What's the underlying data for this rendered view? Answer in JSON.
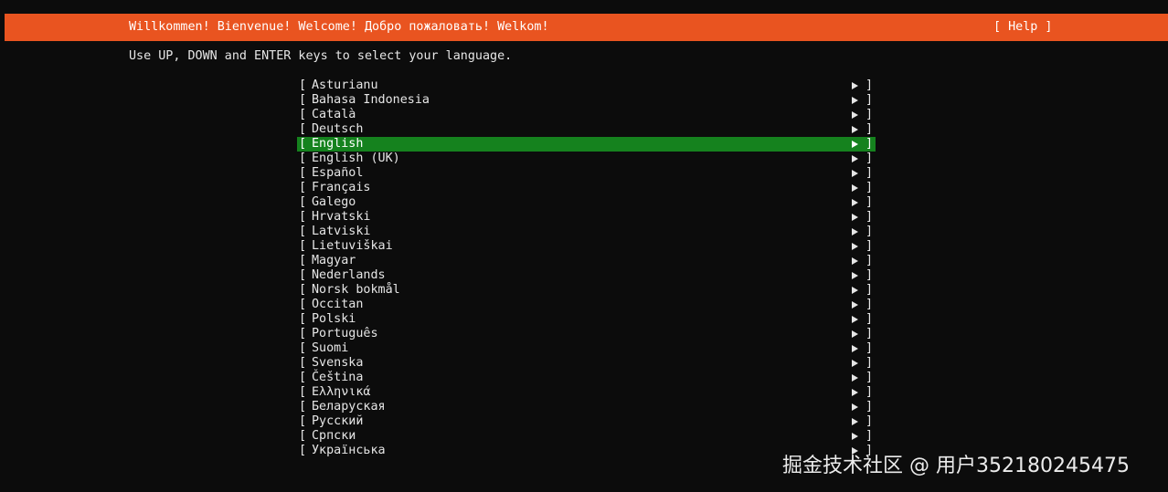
{
  "header": {
    "title": "Willkommen! Bienvenue! Welcome! Добро пожаловать! Welkom!",
    "help_label": "[ Help ]"
  },
  "instructions": "Use UP, DOWN and ENTER keys to select your language.",
  "languages": {
    "items": [
      {
        "label": "Asturianu"
      },
      {
        "label": "Bahasa Indonesia"
      },
      {
        "label": "Català"
      },
      {
        "label": "Deutsch"
      },
      {
        "label": "English",
        "selected": true
      },
      {
        "label": "English (UK)"
      },
      {
        "label": "Español"
      },
      {
        "label": "Français"
      },
      {
        "label": "Galego"
      },
      {
        "label": "Hrvatski"
      },
      {
        "label": "Latviski"
      },
      {
        "label": "Lietuviškai"
      },
      {
        "label": "Magyar"
      },
      {
        "label": "Nederlands"
      },
      {
        "label": "Norsk bokmål"
      },
      {
        "label": "Occitan"
      },
      {
        "label": "Polski"
      },
      {
        "label": "Português"
      },
      {
        "label": "Suomi"
      },
      {
        "label": "Svenska"
      },
      {
        "label": "Čeština"
      },
      {
        "label": "Ελληνικά"
      },
      {
        "label": "Беларуская"
      },
      {
        "label": "Русский"
      },
      {
        "label": "Српски"
      },
      {
        "label": "Українська"
      }
    ],
    "bracket_open": "[",
    "bracket_close": "]",
    "arrow_icon": "right-triangle-icon"
  },
  "watermark": "掘金技术社区 @ 用户352180245475",
  "colors": {
    "header_bg": "#e95420",
    "selected_bg": "#15821e",
    "screen_bg": "#0c0c0c",
    "text": "#e6e6e6"
  }
}
